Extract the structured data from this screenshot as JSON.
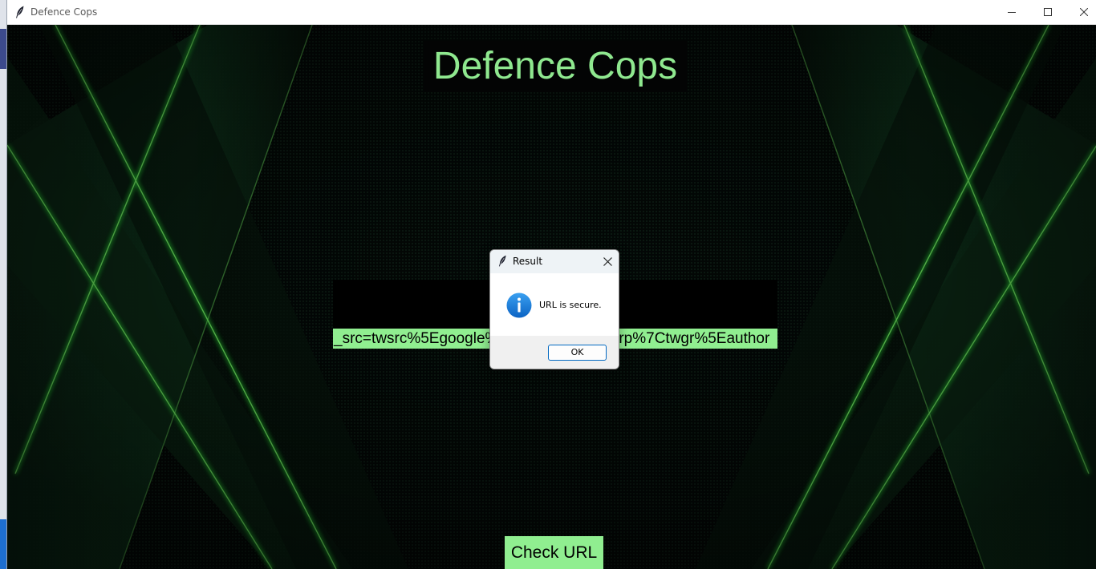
{
  "window": {
    "title": "Defence Cops",
    "controls": {
      "minimize": "minimize-icon",
      "maximize": "maximize-icon",
      "close": "close-icon"
    }
  },
  "app": {
    "heading": "Defence Cops",
    "url_value": "_src=twsrc%5Egoogle%7Ctwcamp%5Eserp%7Ctwgr%5Eauthor",
    "check_button": "Check URL"
  },
  "dialog": {
    "title": "Result",
    "message": "URL is secure.",
    "ok_label": "OK",
    "icon": "info-icon"
  },
  "colors": {
    "accent_green": "#90ee90",
    "dialog_button_border": "#0067c0",
    "info_blue": "#1a7fd9"
  }
}
